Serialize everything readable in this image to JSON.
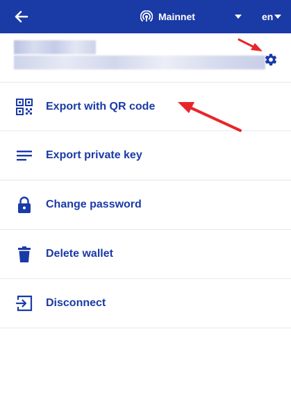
{
  "header": {
    "back_icon": "arrow-left-icon",
    "network_icon": "broadcast-icon",
    "network_label": "Mainnet",
    "language_label": "en",
    "background_color": "#1a3aa6"
  },
  "account": {
    "settings_icon": "gear-icon"
  },
  "menu": {
    "items": [
      {
        "icon": "qr-code-icon",
        "label": "Export with QR code"
      },
      {
        "icon": "list-lines-icon",
        "label": "Export private key"
      },
      {
        "icon": "lock-icon",
        "label": "Change password"
      },
      {
        "icon": "trash-icon",
        "label": "Delete wallet"
      },
      {
        "icon": "exit-icon",
        "label": "Disconnect"
      }
    ],
    "label_color": "#1a3aa6"
  },
  "annotations": {
    "arrow_color": "#e8262a"
  }
}
